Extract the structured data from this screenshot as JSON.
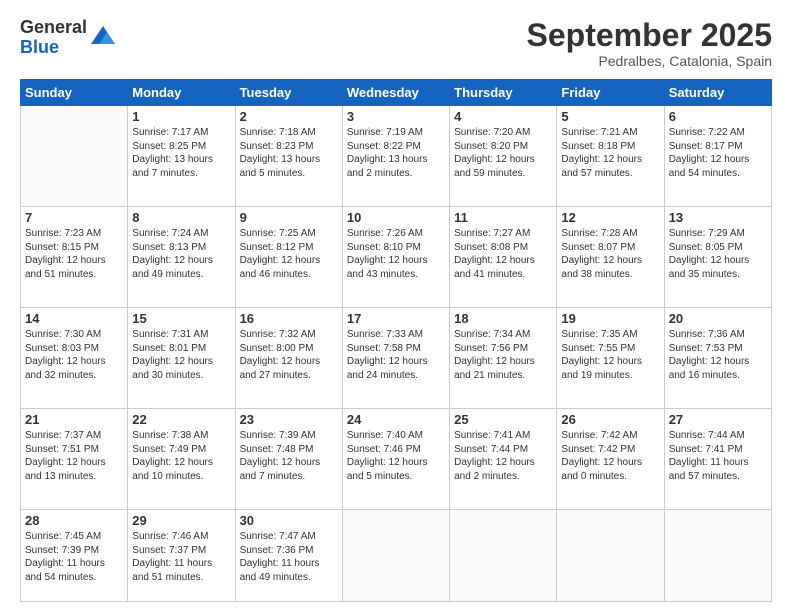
{
  "logo": {
    "general": "General",
    "blue": "Blue"
  },
  "header": {
    "month": "September 2025",
    "location": "Pedralbes, Catalonia, Spain"
  },
  "weekdays": [
    "Sunday",
    "Monday",
    "Tuesday",
    "Wednesday",
    "Thursday",
    "Friday",
    "Saturday"
  ],
  "weeks": [
    [
      {
        "day": "",
        "lines": []
      },
      {
        "day": "1",
        "lines": [
          "Sunrise: 7:17 AM",
          "Sunset: 8:25 PM",
          "Daylight: 13 hours",
          "and 7 minutes."
        ]
      },
      {
        "day": "2",
        "lines": [
          "Sunrise: 7:18 AM",
          "Sunset: 8:23 PM",
          "Daylight: 13 hours",
          "and 5 minutes."
        ]
      },
      {
        "day": "3",
        "lines": [
          "Sunrise: 7:19 AM",
          "Sunset: 8:22 PM",
          "Daylight: 13 hours",
          "and 2 minutes."
        ]
      },
      {
        "day": "4",
        "lines": [
          "Sunrise: 7:20 AM",
          "Sunset: 8:20 PM",
          "Daylight: 12 hours",
          "and 59 minutes."
        ]
      },
      {
        "day": "5",
        "lines": [
          "Sunrise: 7:21 AM",
          "Sunset: 8:18 PM",
          "Daylight: 12 hours",
          "and 57 minutes."
        ]
      },
      {
        "day": "6",
        "lines": [
          "Sunrise: 7:22 AM",
          "Sunset: 8:17 PM",
          "Daylight: 12 hours",
          "and 54 minutes."
        ]
      }
    ],
    [
      {
        "day": "7",
        "lines": [
          "Sunrise: 7:23 AM",
          "Sunset: 8:15 PM",
          "Daylight: 12 hours",
          "and 51 minutes."
        ]
      },
      {
        "day": "8",
        "lines": [
          "Sunrise: 7:24 AM",
          "Sunset: 8:13 PM",
          "Daylight: 12 hours",
          "and 49 minutes."
        ]
      },
      {
        "day": "9",
        "lines": [
          "Sunrise: 7:25 AM",
          "Sunset: 8:12 PM",
          "Daylight: 12 hours",
          "and 46 minutes."
        ]
      },
      {
        "day": "10",
        "lines": [
          "Sunrise: 7:26 AM",
          "Sunset: 8:10 PM",
          "Daylight: 12 hours",
          "and 43 minutes."
        ]
      },
      {
        "day": "11",
        "lines": [
          "Sunrise: 7:27 AM",
          "Sunset: 8:08 PM",
          "Daylight: 12 hours",
          "and 41 minutes."
        ]
      },
      {
        "day": "12",
        "lines": [
          "Sunrise: 7:28 AM",
          "Sunset: 8:07 PM",
          "Daylight: 12 hours",
          "and 38 minutes."
        ]
      },
      {
        "day": "13",
        "lines": [
          "Sunrise: 7:29 AM",
          "Sunset: 8:05 PM",
          "Daylight: 12 hours",
          "and 35 minutes."
        ]
      }
    ],
    [
      {
        "day": "14",
        "lines": [
          "Sunrise: 7:30 AM",
          "Sunset: 8:03 PM",
          "Daylight: 12 hours",
          "and 32 minutes."
        ]
      },
      {
        "day": "15",
        "lines": [
          "Sunrise: 7:31 AM",
          "Sunset: 8:01 PM",
          "Daylight: 12 hours",
          "and 30 minutes."
        ]
      },
      {
        "day": "16",
        "lines": [
          "Sunrise: 7:32 AM",
          "Sunset: 8:00 PM",
          "Daylight: 12 hours",
          "and 27 minutes."
        ]
      },
      {
        "day": "17",
        "lines": [
          "Sunrise: 7:33 AM",
          "Sunset: 7:58 PM",
          "Daylight: 12 hours",
          "and 24 minutes."
        ]
      },
      {
        "day": "18",
        "lines": [
          "Sunrise: 7:34 AM",
          "Sunset: 7:56 PM",
          "Daylight: 12 hours",
          "and 21 minutes."
        ]
      },
      {
        "day": "19",
        "lines": [
          "Sunrise: 7:35 AM",
          "Sunset: 7:55 PM",
          "Daylight: 12 hours",
          "and 19 minutes."
        ]
      },
      {
        "day": "20",
        "lines": [
          "Sunrise: 7:36 AM",
          "Sunset: 7:53 PM",
          "Daylight: 12 hours",
          "and 16 minutes."
        ]
      }
    ],
    [
      {
        "day": "21",
        "lines": [
          "Sunrise: 7:37 AM",
          "Sunset: 7:51 PM",
          "Daylight: 12 hours",
          "and 13 minutes."
        ]
      },
      {
        "day": "22",
        "lines": [
          "Sunrise: 7:38 AM",
          "Sunset: 7:49 PM",
          "Daylight: 12 hours",
          "and 10 minutes."
        ]
      },
      {
        "day": "23",
        "lines": [
          "Sunrise: 7:39 AM",
          "Sunset: 7:48 PM",
          "Daylight: 12 hours",
          "and 7 minutes."
        ]
      },
      {
        "day": "24",
        "lines": [
          "Sunrise: 7:40 AM",
          "Sunset: 7:46 PM",
          "Daylight: 12 hours",
          "and 5 minutes."
        ]
      },
      {
        "day": "25",
        "lines": [
          "Sunrise: 7:41 AM",
          "Sunset: 7:44 PM",
          "Daylight: 12 hours",
          "and 2 minutes."
        ]
      },
      {
        "day": "26",
        "lines": [
          "Sunrise: 7:42 AM",
          "Sunset: 7:42 PM",
          "Daylight: 12 hours",
          "and 0 minutes."
        ]
      },
      {
        "day": "27",
        "lines": [
          "Sunrise: 7:44 AM",
          "Sunset: 7:41 PM",
          "Daylight: 11 hours",
          "and 57 minutes."
        ]
      }
    ],
    [
      {
        "day": "28",
        "lines": [
          "Sunrise: 7:45 AM",
          "Sunset: 7:39 PM",
          "Daylight: 11 hours",
          "and 54 minutes."
        ]
      },
      {
        "day": "29",
        "lines": [
          "Sunrise: 7:46 AM",
          "Sunset: 7:37 PM",
          "Daylight: 11 hours",
          "and 51 minutes."
        ]
      },
      {
        "day": "30",
        "lines": [
          "Sunrise: 7:47 AM",
          "Sunset: 7:36 PM",
          "Daylight: 11 hours",
          "and 49 minutes."
        ]
      },
      {
        "day": "",
        "lines": []
      },
      {
        "day": "",
        "lines": []
      },
      {
        "day": "",
        "lines": []
      },
      {
        "day": "",
        "lines": []
      }
    ]
  ]
}
